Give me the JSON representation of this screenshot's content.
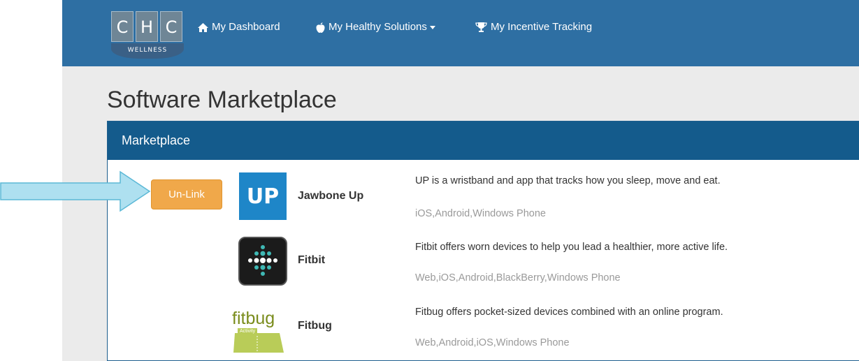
{
  "brand": {
    "letters": [
      "C",
      "H",
      "C"
    ],
    "subtitle": "WELLNESS"
  },
  "nav": {
    "dashboard": "My Dashboard",
    "healthy_solutions": "My Healthy Solutions",
    "incentive_tracking": "My Incentive Tracking"
  },
  "page": {
    "title": "Software Marketplace"
  },
  "panel": {
    "heading": "Marketplace",
    "unlink_label": "Un-Link"
  },
  "apps": [
    {
      "name": "Jawbone Up",
      "logo_text": "UP",
      "description": "UP is a wristband and app that tracks how you sleep, move and eat.",
      "platforms": "iOS,Android,Windows Phone"
    },
    {
      "name": "Fitbit",
      "description": "Fitbit offers worn devices to help you lead a healthier, more active life.",
      "platforms": "Web,iOS,Android,BlackBerry,Windows Phone"
    },
    {
      "name": "Fitbug",
      "logo_text": "fitbug",
      "logo_subtext": "Activity",
      "description": "Fitbug offers pocket-sized devices combined with an online program.",
      "platforms": "Web,Android,iOS,Windows Phone"
    }
  ],
  "colors": {
    "navbar": "#2e6fa3",
    "panel_heading": "#145b8c",
    "unlink_button": "#f0a84a",
    "arrow_fill": "#aee0f0"
  }
}
